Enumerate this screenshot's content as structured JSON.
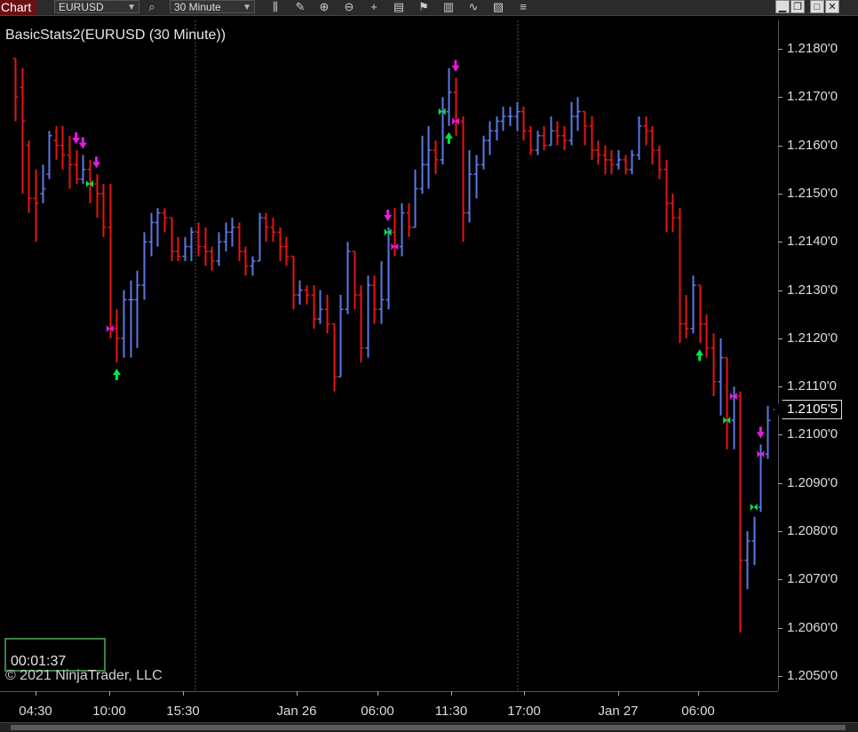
{
  "toolbar": {
    "title": "Chart",
    "instrument": "EURUSD",
    "interval": "30 Minute",
    "icons": [
      "search-icon",
      "bar-type-icon",
      "draw-icon",
      "zoom-in-icon",
      "zoom-out-icon",
      "crosshair-icon",
      "data-box-icon",
      "indicators-icon",
      "strategies-icon",
      "chart-style-icon",
      "properties-icon",
      "menu-icon"
    ]
  },
  "window_controls": {
    "minimize": "▁",
    "restore": "❐",
    "maximize": "□",
    "close": "✕"
  },
  "chart": {
    "title": "BasicStats2(EURUSD (30 Minute))",
    "timer": "00:01:37",
    "copyright": "© 2021 NinjaTrader, LLC",
    "current_price": "1.2105'5",
    "colors": {
      "up": "#5b78e6",
      "down": "#e81414",
      "up_arrow": "#00e640",
      "down_arrow": "#e619e6"
    }
  },
  "chart_data": {
    "type": "bar",
    "yticks": [
      "1.2180'0",
      "1.2170'0",
      "1.2160'0",
      "1.2150'0",
      "1.2140'0",
      "1.2130'0",
      "1.2120'0",
      "1.2110'0",
      "1.2100'0",
      "1.2090'0",
      "1.2080'0",
      "1.2070'0",
      "1.2060'0",
      "1.2050'0"
    ],
    "ytick_values": [
      1.218,
      1.217,
      1.216,
      1.215,
      1.214,
      1.213,
      1.212,
      1.211,
      1.21,
      1.209,
      1.208,
      1.207,
      1.206,
      1.205
    ],
    "xticks": [
      "04:30",
      "10:00",
      "15:30",
      "Jan 26",
      "06:00",
      "11:30",
      "17:00",
      "Jan 27",
      "06:00"
    ],
    "ylim": [
      1.2047,
      1.2187
    ],
    "ohlc": [
      [
        1.2178,
        1.2178,
        1.2165,
        1.217
      ],
      [
        1.2172,
        1.2176,
        1.215,
        1.2165
      ],
      [
        1.216,
        1.2161,
        1.2146,
        1.2149
      ],
      [
        1.2149,
        1.2155,
        1.214,
        1.2148
      ],
      [
        1.215,
        1.2156,
        1.2148,
        1.2151
      ],
      [
        1.2154,
        1.2163,
        1.2153,
        1.2162
      ],
      [
        1.2161,
        1.2164,
        1.2157,
        1.216
      ],
      [
        1.216,
        1.2164,
        1.2155,
        1.2158
      ],
      [
        1.2158,
        1.2162,
        1.2151,
        1.2156
      ],
      [
        1.2156,
        1.2159,
        1.2152,
        1.2153
      ],
      [
        1.2153,
        1.2158,
        1.2152,
        1.2155
      ],
      [
        1.2155,
        1.2157,
        1.2148,
        1.2152
      ],
      [
        1.2152,
        1.2154,
        1.2145,
        1.215
      ],
      [
        1.215,
        1.2152,
        1.2141,
        1.2143
      ],
      [
        1.2143,
        1.2152,
        1.212,
        1.2122
      ],
      [
        1.2122,
        1.2126,
        1.2115,
        1.212
      ],
      [
        1.212,
        1.213,
        1.2116,
        1.2128
      ],
      [
        1.2128,
        1.2132,
        1.2116,
        1.2128
      ],
      [
        1.2128,
        1.2134,
        1.2118,
        1.2131
      ],
      [
        1.2131,
        1.2142,
        1.2128,
        1.214
      ],
      [
        1.214,
        1.2146,
        1.2137,
        1.2144
      ],
      [
        1.2144,
        1.2147,
        1.2139,
        1.2146
      ],
      [
        1.2146,
        1.2147,
        1.2142,
        1.2145
      ],
      [
        1.2145,
        1.2145,
        1.2136,
        1.2138
      ],
      [
        1.2138,
        1.2141,
        1.2136,
        1.2137
      ],
      [
        1.2137,
        1.2141,
        1.2136,
        1.2139
      ],
      [
        1.2139,
        1.2143,
        1.2136,
        1.2142
      ],
      [
        1.2142,
        1.2144,
        1.2137,
        1.2139
      ],
      [
        1.2139,
        1.2143,
        1.2135,
        1.2138
      ],
      [
        1.2138,
        1.2139,
        1.2134,
        1.2136
      ],
      [
        1.2136,
        1.2142,
        1.2135,
        1.214
      ],
      [
        1.214,
        1.2144,
        1.2138,
        1.2142
      ],
      [
        1.2142,
        1.2145,
        1.2139,
        1.2143
      ],
      [
        1.2143,
        1.2144,
        1.2136,
        1.2138
      ],
      [
        1.2138,
        1.2139,
        1.2133,
        1.2135
      ],
      [
        1.2135,
        1.2137,
        1.2133,
        1.2136
      ],
      [
        1.2136,
        1.2146,
        1.2136,
        1.2145
      ],
      [
        1.2145,
        1.2146,
        1.214,
        1.2143
      ],
      [
        1.2143,
        1.2145,
        1.214,
        1.2142
      ],
      [
        1.2142,
        1.2143,
        1.2136,
        1.2139
      ],
      [
        1.2139,
        1.2141,
        1.2135,
        1.2137
      ],
      [
        1.2137,
        1.2137,
        1.2126,
        1.2129
      ],
      [
        1.2129,
        1.2132,
        1.2127,
        1.213
      ],
      [
        1.213,
        1.2131,
        1.2127,
        1.2129
      ],
      [
        1.2129,
        1.2131,
        1.2122,
        1.2124
      ],
      [
        1.2124,
        1.213,
        1.2123,
        1.2126
      ],
      [
        1.2126,
        1.2129,
        1.2121,
        1.2123
      ],
      [
        1.2123,
        1.2123,
        1.2109,
        1.2112
      ],
      [
        1.2112,
        1.2129,
        1.2112,
        1.2126
      ],
      [
        1.2126,
        1.214,
        1.2125,
        1.2138
      ],
      [
        1.2138,
        1.2138,
        1.2126,
        1.2129
      ],
      [
        1.2129,
        1.2131,
        1.2115,
        1.2118
      ],
      [
        1.2118,
        1.2133,
        1.2116,
        1.2131
      ],
      [
        1.2131,
        1.2133,
        1.2123,
        1.2126
      ],
      [
        1.2126,
        1.2136,
        1.2123,
        1.2128
      ],
      [
        1.2128,
        1.2143,
        1.2126,
        1.2142
      ],
      [
        1.2142,
        1.2147,
        1.2137,
        1.2139
      ],
      [
        1.2139,
        1.2148,
        1.2137,
        1.2146
      ],
      [
        1.2146,
        1.2148,
        1.2141,
        1.2143
      ],
      [
        1.2143,
        1.2155,
        1.2143,
        1.2151
      ],
      [
        1.2151,
        1.2162,
        1.215,
        1.2156
      ],
      [
        1.2156,
        1.2164,
        1.2151,
        1.2159
      ],
      [
        1.2159,
        1.2161,
        1.2154,
        1.2157
      ],
      [
        1.2157,
        1.217,
        1.2156,
        1.2167
      ],
      [
        1.2167,
        1.2176,
        1.2164,
        1.2171
      ],
      [
        1.2171,
        1.2174,
        1.2162,
        1.2165
      ],
      [
        1.2165,
        1.2166,
        1.214,
        1.2146
      ],
      [
        1.2146,
        1.2159,
        1.2144,
        1.2154
      ],
      [
        1.2154,
        1.2158,
        1.2149,
        1.2156
      ],
      [
        1.2156,
        1.2162,
        1.2155,
        1.2161
      ],
      [
        1.2161,
        1.2165,
        1.2158,
        1.2163
      ],
      [
        1.2163,
        1.2166,
        1.2161,
        1.2165
      ],
      [
        1.2165,
        1.2168,
        1.2163,
        1.2166
      ],
      [
        1.2166,
        1.2168,
        1.2164,
        1.2166
      ],
      [
        1.2166,
        1.2169,
        1.2163,
        1.2167
      ],
      [
        1.2167,
        1.2168,
        1.2161,
        1.2163
      ],
      [
        1.2163,
        1.2164,
        1.2158,
        1.2159
      ],
      [
        1.2159,
        1.2163,
        1.2158,
        1.2162
      ],
      [
        1.2162,
        1.2164,
        1.2159,
        1.216
      ],
      [
        1.216,
        1.2166,
        1.216,
        1.2163
      ],
      [
        1.2163,
        1.2165,
        1.216,
        1.2162
      ],
      [
        1.2162,
        1.2164,
        1.2159,
        1.2161
      ],
      [
        1.2161,
        1.2169,
        1.216,
        1.2166
      ],
      [
        1.2166,
        1.217,
        1.2163,
        1.2167
      ],
      [
        1.2167,
        1.2167,
        1.216,
        1.2164
      ],
      [
        1.2164,
        1.2166,
        1.2157,
        1.2159
      ],
      [
        1.2159,
        1.2161,
        1.2156,
        1.2158
      ],
      [
        1.2158,
        1.216,
        1.2154,
        1.2157
      ],
      [
        1.2157,
        1.2159,
        1.2154,
        1.2156
      ],
      [
        1.2156,
        1.2159,
        1.2155,
        1.2157
      ],
      [
        1.2157,
        1.2158,
        1.2154,
        1.2155
      ],
      [
        1.2155,
        1.2159,
        1.2154,
        1.2158
      ],
      [
        1.2158,
        1.2166,
        1.2157,
        1.2164
      ],
      [
        1.2164,
        1.2166,
        1.216,
        1.2163
      ],
      [
        1.2163,
        1.2164,
        1.2156,
        1.2159
      ],
      [
        1.2159,
        1.216,
        1.2153,
        1.2155
      ],
      [
        1.2155,
        1.2157,
        1.2142,
        1.2148
      ],
      [
        1.2148,
        1.215,
        1.2142,
        1.2145
      ],
      [
        1.2145,
        1.2147,
        1.2119,
        1.2123
      ],
      [
        1.2123,
        1.2129,
        1.212,
        1.2122
      ],
      [
        1.2122,
        1.2133,
        1.2121,
        1.2131
      ],
      [
        1.2131,
        1.2131,
        1.2119,
        1.2123
      ],
      [
        1.2123,
        1.2125,
        1.2116,
        1.2118
      ],
      [
        1.2118,
        1.2121,
        1.2108,
        1.2111
      ],
      [
        1.2111,
        1.212,
        1.2104,
        1.2116
      ],
      [
        1.2116,
        1.2116,
        1.2097,
        1.2103
      ],
      [
        1.2103,
        1.211,
        1.2097,
        1.2108
      ],
      [
        1.2108,
        1.2109,
        1.2059,
        1.2074
      ],
      [
        1.2074,
        1.208,
        1.2068,
        1.2078
      ],
      [
        1.2078,
        1.2083,
        1.2073,
        1.2085
      ],
      [
        1.2085,
        1.2098,
        1.2084,
        1.2096
      ],
      [
        1.2096,
        1.2106,
        1.2095,
        1.2103
      ]
    ],
    "up_arrows": [
      15,
      64,
      101
    ],
    "down_arrows": [
      9,
      10,
      12,
      55,
      65,
      110
    ],
    "marker_bars": [
      11,
      14,
      55,
      56,
      63,
      65,
      105,
      106,
      109,
      110
    ]
  }
}
